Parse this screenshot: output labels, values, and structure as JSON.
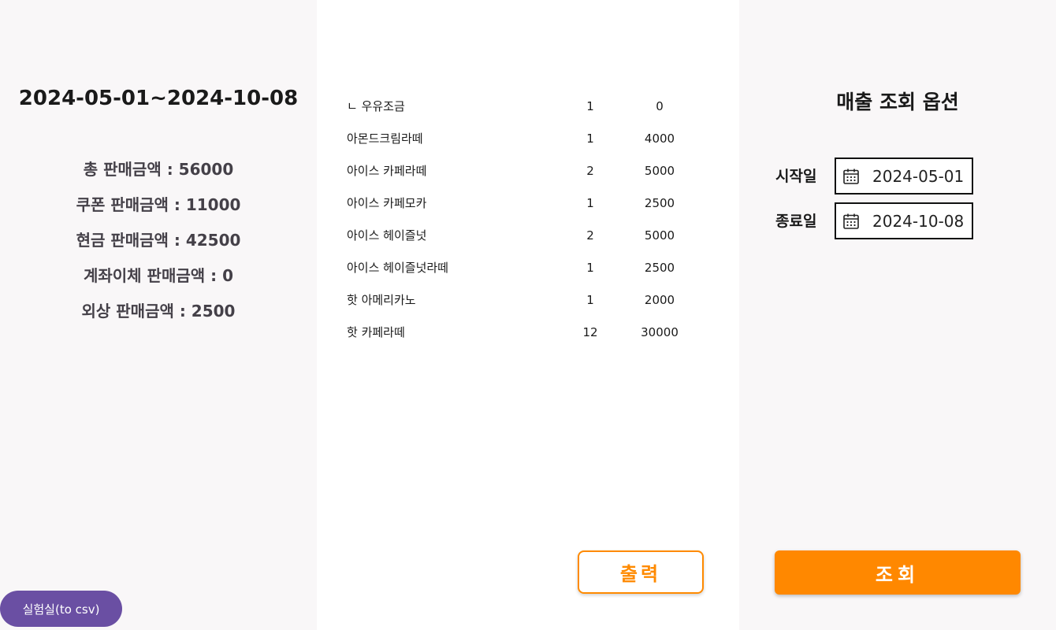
{
  "summary": {
    "date_range": "2024-05-01~2024-10-08",
    "rows": [
      "총 판매금액 : 56000",
      "쿠폰 판매금액 : 11000",
      "현금 판매금액 : 42500",
      "계좌이체 판매금액 : 0",
      "외상 판매금액 : 2500"
    ]
  },
  "lab_button": {
    "label": "실험실(to csv)"
  },
  "items": [
    {
      "name": "ㄴ 우유조금",
      "qty": "1",
      "amount": "0"
    },
    {
      "name": "아몬드크림라떼",
      "qty": "1",
      "amount": "4000"
    },
    {
      "name": "아이스 카페라떼",
      "qty": "2",
      "amount": "5000"
    },
    {
      "name": "아이스 카페모카",
      "qty": "1",
      "amount": "2500"
    },
    {
      "name": "아이스 헤이즐넛",
      "qty": "2",
      "amount": "5000"
    },
    {
      "name": "아이스 헤이즐넛라떼",
      "qty": "1",
      "amount": "2500"
    },
    {
      "name": "핫 아메리카노",
      "qty": "1",
      "amount": "2000"
    },
    {
      "name": "핫 카페라떼",
      "qty": "12",
      "amount": "30000"
    }
  ],
  "print_button": {
    "label": "출력"
  },
  "options": {
    "title": "매출 조회 옵션",
    "start_label": "시작일",
    "start_value": "2024-05-01",
    "end_label": "종료일",
    "end_value": "2024-10-08",
    "search_label": "조회"
  },
  "colors": {
    "accent": "#ff8800",
    "lab_button": "#6a4fa3",
    "panel_bg": "#f9f7f8"
  },
  "icons": {
    "date_field": "calendar-icon"
  }
}
